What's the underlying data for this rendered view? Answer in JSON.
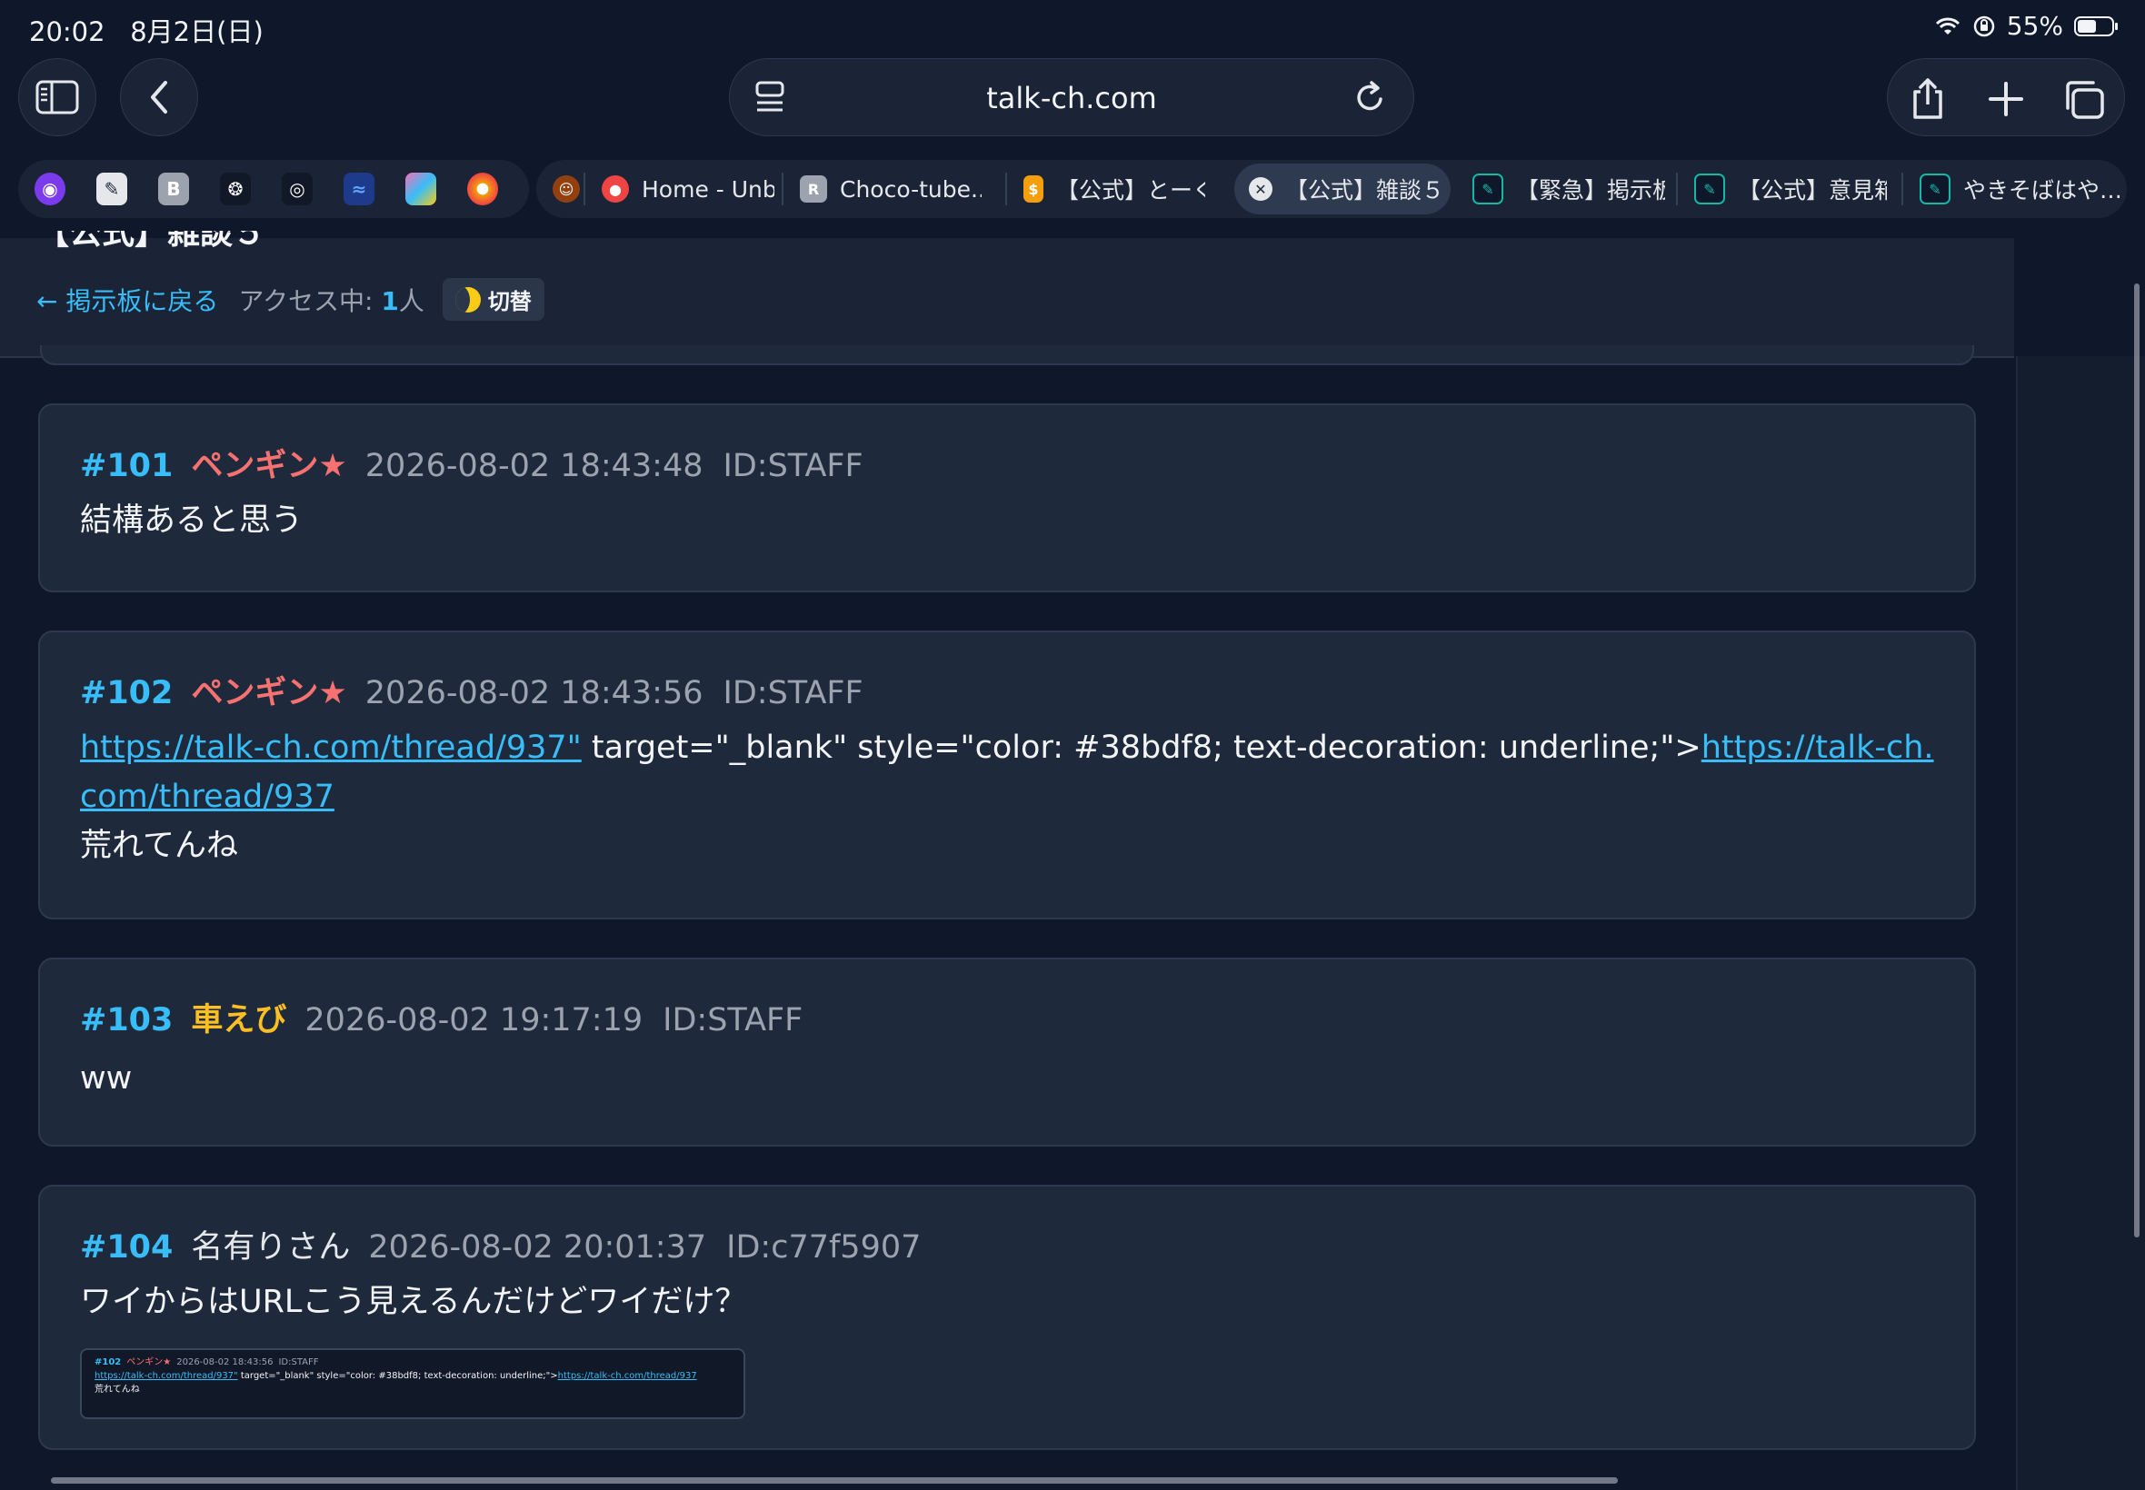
{
  "status_bar": {
    "time": "20:02",
    "date": "8月2日(日)",
    "battery": "55%",
    "battery_level": 0.55
  },
  "toolbar": {
    "url": "talk-ch.com"
  },
  "favorites": [
    {
      "icon": "globe-icon",
      "color": "#7c3aed",
      "letter": ""
    },
    {
      "icon": "note-edit-icon",
      "color": "#e5e7eb",
      "letter": ""
    },
    {
      "icon": "b-icon",
      "color": "#9ca3af",
      "letter": "B"
    },
    {
      "icon": "openai-icon",
      "color": "#111827",
      "letter": ""
    },
    {
      "icon": "ring-icon",
      "color": "#111827",
      "letter": ""
    },
    {
      "icon": "whale-icon",
      "color": "#1e3a8a",
      "letter": ""
    },
    {
      "icon": "copilot-icon",
      "color": "#0ea5e9",
      "letter": ""
    },
    {
      "icon": "chrome-badge-icon",
      "color": "#ef4444",
      "letter": ""
    }
  ],
  "tabs": [
    {
      "label": "",
      "icon_letter": "",
      "color": "#a16207"
    },
    {
      "label": "Home - Unbl...",
      "icon_letter": "",
      "color": "#ef4444"
    },
    {
      "label": "Choco-tube...",
      "icon_letter": "R",
      "color": "#9ca3af"
    },
    {
      "label": "【公式】とーく…",
      "icon_letter": "",
      "color": "#f59e0b"
    },
    {
      "label": "【公式】雑談５",
      "icon_letter": "",
      "color": "#e5e7eb"
    },
    {
      "label": "【緊急】掲示板…",
      "icon_letter": "",
      "color": "#14b8a6"
    },
    {
      "label": "【公式】意見箱…",
      "icon_letter": "",
      "color": "#14b8a6"
    },
    {
      "label": "やきそばはや…",
      "icon_letter": "",
      "color": "#14b8a6"
    }
  ],
  "thread": {
    "title": "【公式】雑談５",
    "back_label": "← 掲示板に戻る",
    "access_label": "アクセス中: ",
    "access_count": "1",
    "access_unit": "人",
    "toggle_label": "切替"
  },
  "posts": [
    {
      "number": "#101",
      "name": "ペンギン★",
      "date": "2026-08-02 18:43:48",
      "id": "ID:STAFF",
      "body": "結構あると思う"
    },
    {
      "number": "#102",
      "name": "ペンギン★",
      "date": "2026-08-02 18:43:56",
      "id": "ID:STAFF",
      "link1": "https://talk-ch.com/thread/937\"",
      "middle": " target=\"_blank\" style=\"color: #38bdf8; text-decoration: underline;\">",
      "link2": "https://talk-ch.com/thread/937",
      "body": "荒れてんね"
    },
    {
      "number": "#103",
      "name": "車えび",
      "date": "2026-08-02 19:17:19",
      "id": "ID:STAFF",
      "body": "ww"
    },
    {
      "number": "#104",
      "name": "名有りさん",
      "date": "2026-08-02 20:01:37",
      "id": "ID:c77f5907",
      "body": "ワイからはURLこう見えるんだけどワイだけ？"
    }
  ],
  "thumbnail": {
    "number": "#102",
    "name": "ペンギン★",
    "date": "2026-08-02 18:43:56",
    "id": "ID:STAFF",
    "link1": "https://talk-ch.com/thread/937\"",
    "middle": " target=\"_blank\" style=\"color: #38bdf8; text-decoration: underline;\">",
    "link2": "https://talk-ch.com/thread/937",
    "body": "荒れてんね"
  }
}
